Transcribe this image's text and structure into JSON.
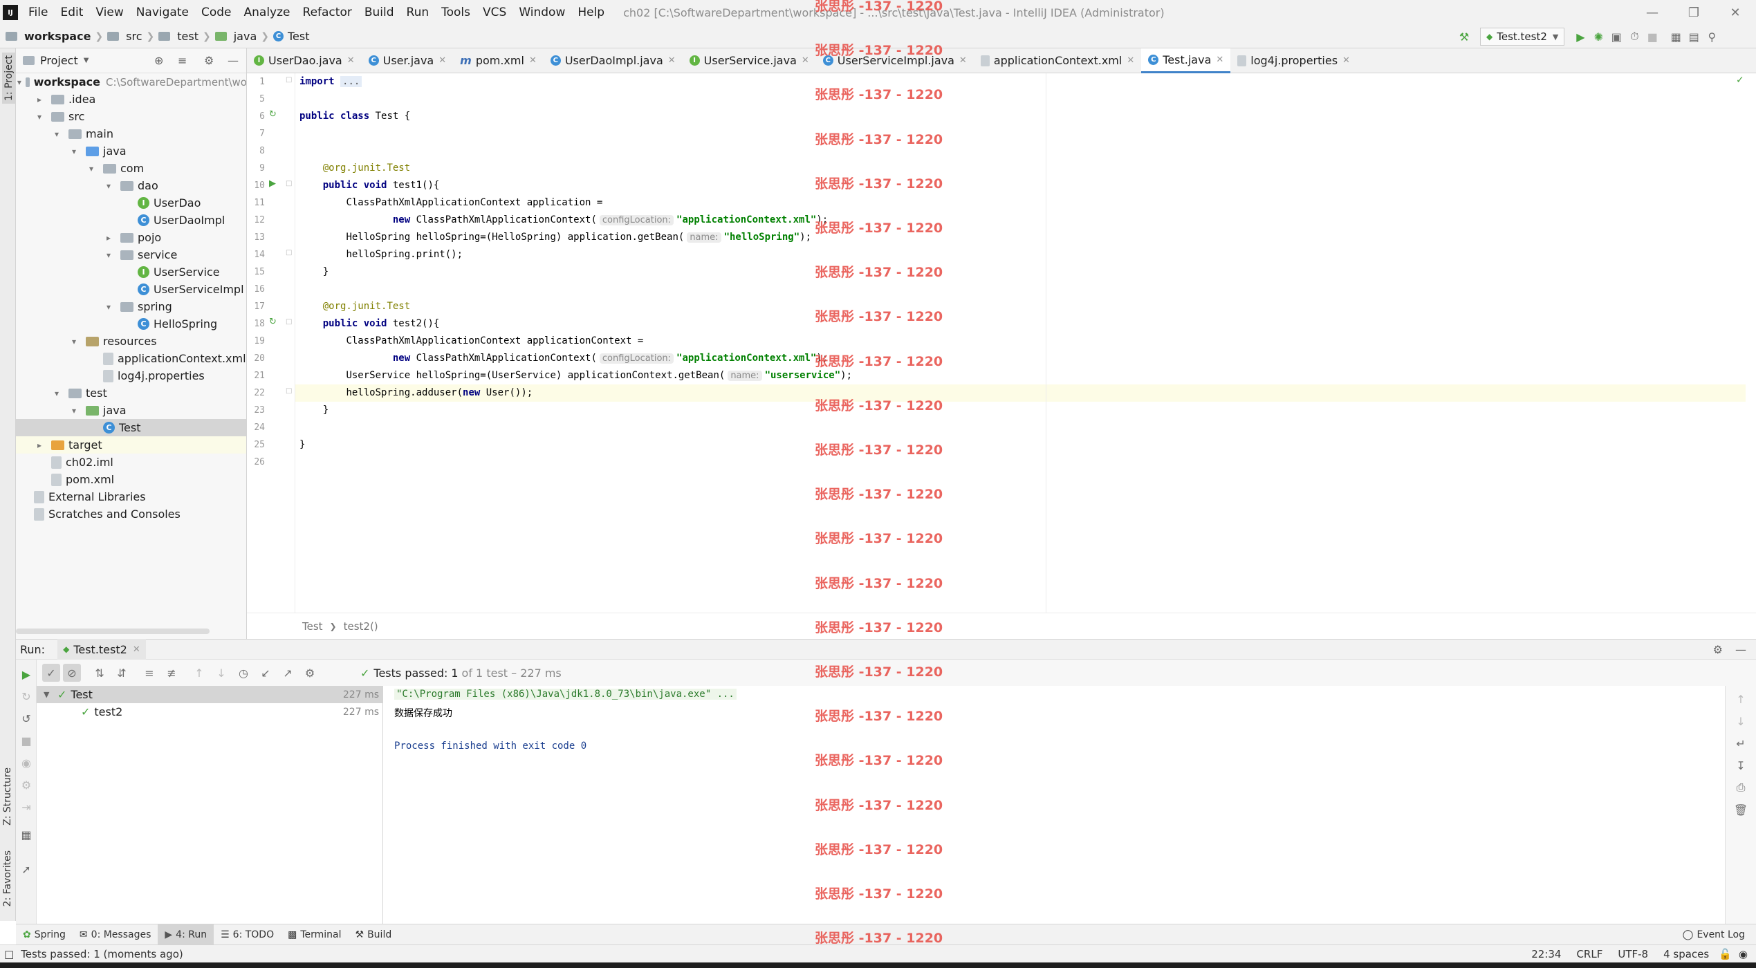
{
  "menubar": {
    "items": [
      "File",
      "Edit",
      "View",
      "Navigate",
      "Code",
      "Analyze",
      "Refactor",
      "Build",
      "Run",
      "Tools",
      "VCS",
      "Window",
      "Help"
    ],
    "title": "ch02 [C:\\SoftwareDepartment\\workspace] - ...\\src\\test\\java\\Test.java - IntelliJ IDEA (Administrator)"
  },
  "navbar": {
    "breadcrumbs": [
      "workspace",
      "src",
      "test",
      "java",
      "Test"
    ],
    "run_config": "Test.test2"
  },
  "side_tabs": {
    "project": "1: Project",
    "structure": "Z: Structure",
    "favorites": "2: Favorites"
  },
  "project": {
    "header": "Project",
    "tree": [
      {
        "label": "workspace",
        "extra": "C:\\SoftwareDepartment\\wo",
        "icon": "module",
        "expanded": true
      },
      {
        "label": ".idea",
        "icon": "folder",
        "expanded": false
      },
      {
        "label": "src",
        "icon": "folder",
        "expanded": true
      },
      {
        "label": "main",
        "icon": "folder",
        "expanded": true
      },
      {
        "label": "java",
        "icon": "source-folder",
        "expanded": true
      },
      {
        "label": "com",
        "icon": "package",
        "expanded": true
      },
      {
        "label": "dao",
        "icon": "package",
        "expanded": true
      },
      {
        "label": "UserDao",
        "icon": "interface"
      },
      {
        "label": "UserDaoImpl",
        "icon": "class"
      },
      {
        "label": "pojo",
        "icon": "package",
        "expanded": false
      },
      {
        "label": "service",
        "icon": "package",
        "expanded": true
      },
      {
        "label": "UserService",
        "icon": "interface"
      },
      {
        "label": "UserServiceImpl",
        "icon": "class"
      },
      {
        "label": "spring",
        "icon": "package",
        "expanded": true
      },
      {
        "label": "HelloSpring",
        "icon": "class"
      },
      {
        "label": "resources",
        "icon": "resources-folder",
        "expanded": true
      },
      {
        "label": "applicationContext.xml",
        "icon": "xml-file"
      },
      {
        "label": "log4j.properties",
        "icon": "properties-file"
      },
      {
        "label": "test",
        "icon": "folder",
        "expanded": true
      },
      {
        "label": "java",
        "icon": "test-folder",
        "expanded": true
      },
      {
        "label": "Test",
        "icon": "class"
      },
      {
        "label": "target",
        "icon": "excluded-folder",
        "expanded": false
      },
      {
        "label": "ch02.iml",
        "icon": "iml-file"
      },
      {
        "label": "pom.xml",
        "icon": "maven-file"
      },
      {
        "label": "External Libraries",
        "icon": "libraries"
      },
      {
        "label": "Scratches and Consoles",
        "icon": "scratches"
      }
    ]
  },
  "editor": {
    "tabs": [
      {
        "label": "UserDao.java",
        "icon": "interface"
      },
      {
        "label": "User.java",
        "icon": "class"
      },
      {
        "label": "pom.xml",
        "icon": "maven"
      },
      {
        "label": "UserDaoImpl.java",
        "icon": "class"
      },
      {
        "label": "UserService.java",
        "icon": "interface"
      },
      {
        "label": "UserServiceImpl.java",
        "icon": "class"
      },
      {
        "label": "applicationContext.xml",
        "icon": "xml"
      },
      {
        "label": "Test.java",
        "icon": "class",
        "active": true
      },
      {
        "label": "log4j.properties",
        "icon": "properties"
      }
    ],
    "line_numbers": [
      "1",
      "5",
      "6",
      "7",
      "8",
      "9",
      "10",
      "11",
      "12",
      "13",
      "14",
      "15",
      "16",
      "17",
      "18",
      "19",
      "20",
      "21",
      "22",
      "23",
      "24",
      "25",
      "26"
    ],
    "code": {
      "l1_kw": "import",
      "l1_fold": "...",
      "l6_kw": "public class",
      "l6_rest": " Test {",
      "l9_ann": "@org.junit.",
      "l9_test": "Test",
      "l10_kw": "public void",
      "l10_rest": " test1(){",
      "l11": "ClassPathXmlApplicationContext application =",
      "l12_kw": "new",
      "l12_rest": " ClassPathXmlApplicationContext(",
      "l12_hint": "configLocation:",
      "l12_str": "\"applicationContext.xml\"",
      "l12_end": ");",
      "l13": "HelloSpring helloSpring=(HelloSpring) application.getBean(",
      "l13_hint": "name:",
      "l13_str": "\"helloSpring\"",
      "l13_end": ");",
      "l14": "helloSpring.print();",
      "l15": "}",
      "l17_ann": "@org.junit.",
      "l17_test": "Test",
      "l18_kw": "public void",
      "l18_rest": " test2(){",
      "l19": "ClassPathXmlApplicationContext applicationContext =",
      "l20_kw": "new",
      "l20_rest": " ClassPathXmlApplicationContext(",
      "l20_hint": "configLocation:",
      "l20_str": "\"applicationContext.xml\"",
      "l20_end": ");",
      "l21": "UserService helloSpring=(UserService) applicationContext.getBean(",
      "l21_hint": "name:",
      "l21_str": "\"userservice\"",
      "l21_end": ");",
      "l22_a": "helloSpring.adduser(",
      "l22_kw": "new",
      "l22_b": " User());",
      "l23": "}",
      "l25": "}"
    },
    "breadcrumb": [
      "Test",
      "test2()"
    ]
  },
  "run": {
    "label": "Run:",
    "tab": "Test.test2",
    "status_prefix": "Tests passed:",
    "status_count": "1",
    "status_suffix": "of 1 test – 227 ms",
    "tree": [
      {
        "label": "Test",
        "time": "227 ms"
      },
      {
        "label": "test2",
        "time": "227 ms"
      }
    ],
    "console": [
      "\"C:\\Program Files (x86)\\Java\\jdk1.8.0_73\\bin\\java.exe\" ...",
      "数据保存成功",
      "",
      "Process finished with exit code 0"
    ]
  },
  "bottom_tabs": [
    {
      "label": "Spring"
    },
    {
      "label": "0: Messages"
    },
    {
      "label": "4: Run",
      "active": true
    },
    {
      "label": "6: TODO"
    },
    {
      "label": "Terminal"
    },
    {
      "label": "Build"
    }
  ],
  "event_log": "Event Log",
  "statusbar": {
    "message": "Tests passed: 1 (moments ago)",
    "position": "22:34",
    "line_sep": "CRLF",
    "encoding": "UTF-8",
    "indent": "4 spaces"
  },
  "watermark": "张思彤 -137 - 1220",
  "colors": {
    "accent": "#4083c9",
    "pass": "#4aa43f",
    "keyword": "#000080",
    "string": "#008000",
    "watermark": "#e8554e"
  }
}
